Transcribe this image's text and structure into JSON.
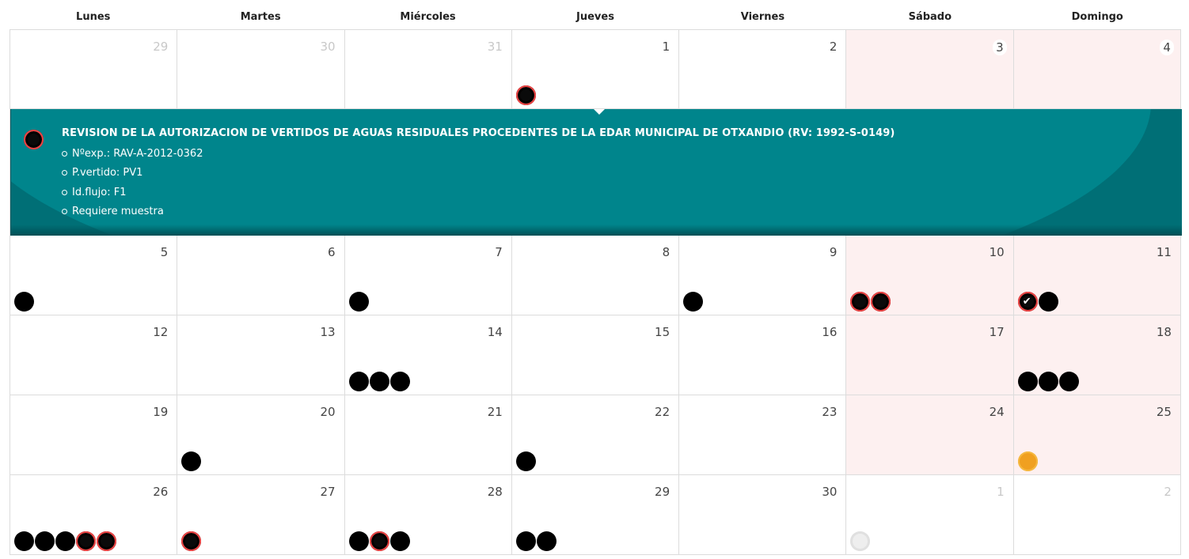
{
  "weekdays": [
    "Lunes",
    "Martes",
    "Miércoles",
    "Jueves",
    "Viernes",
    "Sábado",
    "Domingo"
  ],
  "weeks": [
    [
      "29",
      "30",
      "31",
      "1",
      "2",
      "3",
      "4"
    ],
    [
      "5",
      "6",
      "7",
      "8",
      "9",
      "10",
      "11"
    ],
    [
      "12",
      "13",
      "14",
      "15",
      "16",
      "17",
      "18"
    ],
    [
      "19",
      "20",
      "21",
      "22",
      "23",
      "24",
      "25"
    ],
    [
      "26",
      "27",
      "28",
      "29",
      "30",
      "1",
      "2"
    ]
  ],
  "detail": {
    "title": "REVISION DE LA AUTORIZACION DE VERTIDOS DE AGUAS RESIDUALES PROCEDENTES DE LA EDAR MUNICIPAL DE OTXANDIO (RV: 1992-S-0149)",
    "items": [
      "Nºexp.: RAV-A-2012-0362",
      "P.vertido: PV1",
      "Id.flujo: F1",
      "Requiere muestra"
    ]
  },
  "colors": {
    "event_pending": "#000000",
    "event_selected_ring": "#e84545",
    "event_orange": "#f0a020",
    "event_inactive": "#eeeeee",
    "weekend_bg": "#fdf0f0",
    "detail_bg": "#00797f"
  }
}
